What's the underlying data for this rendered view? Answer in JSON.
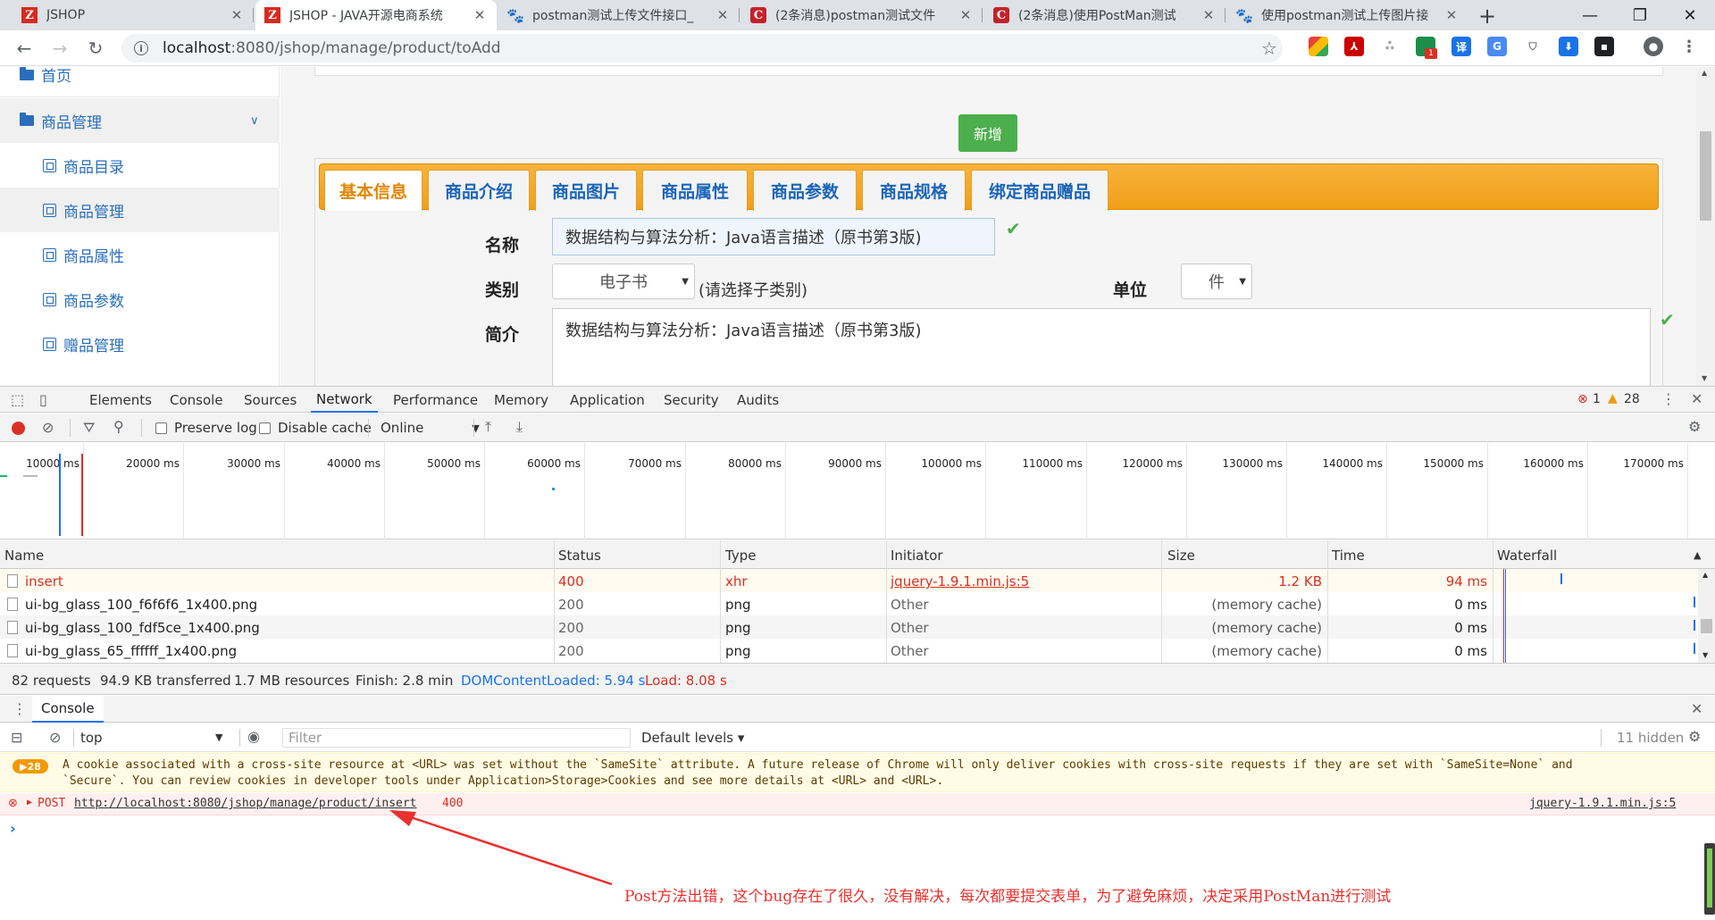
{
  "browser": {
    "tabs": [
      {
        "title": "JSHOP",
        "icon": "jshop-logo-icon"
      },
      {
        "title": "JSHOP - JAVA开源电商系统",
        "icon": "jshop-logo-icon"
      },
      {
        "title": "postman测试上传文件接口_",
        "icon": "baidu-paw-icon"
      },
      {
        "title": "(2条消息)postman测试文件",
        "icon": "csdn-logo-icon"
      },
      {
        "title": "(2条消息)使用PostMan测试",
        "icon": "csdn-logo-icon"
      },
      {
        "title": "使用postman测试上传图片接",
        "icon": "baidu-paw-icon"
      }
    ],
    "address": {
      "host": "localhost",
      "path": ":8080/jshop/manage/product/toAdd"
    },
    "ext_badge": "1",
    "ext_translate_label": "译"
  },
  "sidebar": {
    "home": "首页",
    "product_mgmt": "商品管理",
    "items": [
      "商品目录",
      "商品管理",
      "商品属性",
      "商品参数",
      "赠品管理"
    ]
  },
  "form": {
    "add_button": "新增",
    "tabs": [
      "基本信息",
      "商品介绍",
      "商品图片",
      "商品属性",
      "商品参数",
      "商品规格",
      "绑定商品赠品"
    ],
    "name_label": "名称",
    "name_value": "数据结构与算法分析：Java语言描述（原书第3版)",
    "category_label": "类别",
    "category_value": "电子书",
    "category_hint": "(请选择子类别)",
    "unit_label": "单位",
    "unit_value": "件",
    "intro_label": "简介",
    "intro_value": "数据结构与算法分析：Java语言描述（原书第3版)"
  },
  "devtools": {
    "tabs": [
      "Elements",
      "Console",
      "Sources",
      "Network",
      "Performance",
      "Memory",
      "Application",
      "Security",
      "Audits"
    ],
    "active_tab": "Network",
    "error_count": "1",
    "warning_count": "28",
    "preserve_log": "Preserve log",
    "disable_cache": "Disable cache",
    "throttle": "Online",
    "timeline_ticks": [
      "10000 ms",
      "20000 ms",
      "30000 ms",
      "40000 ms",
      "50000 ms",
      "60000 ms",
      "70000 ms",
      "80000 ms",
      "90000 ms",
      "100000 ms",
      "110000 ms",
      "120000 ms",
      "130000 ms",
      "140000 ms",
      "150000 ms",
      "160000 ms",
      "170000 ms"
    ],
    "columns": [
      "Name",
      "Status",
      "Type",
      "Initiator",
      "Size",
      "Time",
      "Waterfall"
    ],
    "rows": [
      {
        "name": "insert",
        "status": "400",
        "type": "xhr",
        "initiator": "jquery-1.9.1.min.js:5",
        "size": "1.2 KB",
        "time": "94 ms"
      },
      {
        "name": "ui-bg_glass_100_f6f6f6_1x400.png",
        "status": "200",
        "type": "png",
        "initiator": "Other",
        "size": "(memory cache)",
        "time": "0 ms"
      },
      {
        "name": "ui-bg_glass_100_fdf5ce_1x400.png",
        "status": "200",
        "type": "png",
        "initiator": "Other",
        "size": "(memory cache)",
        "time": "0 ms"
      },
      {
        "name": "ui-bg_glass_65_ffffff_1x400.png",
        "status": "200",
        "type": "png",
        "initiator": "Other",
        "size": "(memory cache)",
        "time": "0 ms"
      }
    ],
    "summary": {
      "requests": "82 requests",
      "transferred": "94.9 KB transferred",
      "resources": "1.7 MB resources",
      "finish": "Finish: 2.8 min",
      "dcl": "DOMContentLoaded: 5.94 s",
      "load": "Load: 8.08 s"
    },
    "console": {
      "title": "Console",
      "context": "top",
      "filter_placeholder": "Filter",
      "levels": "Default levels ▾",
      "hidden": "11 hidden",
      "warn_badge": "28",
      "warn_line1": "A cookie associated with a cross-site resource at <URL> was set without the `SameSite` attribute. A future release of Chrome will only deliver cookies with cross-site requests if they are set with `SameSite=None` and",
      "warn_line2": "`Secure`. You can review cookies in developer tools under Application>Storage>Cookies and see more details at <URL> and <URL>.",
      "err_method": "POST",
      "err_url": "http://localhost:8080/jshop/manage/product/insert",
      "err_status": "400",
      "err_source": "jquery-1.9.1.min.js:5"
    }
  },
  "annotation": "Post方法出错，这个bug存在了很久，没有解决，每次都要提交表单，为了避免麻烦，决定采用PostMan进行测试",
  "colors": {
    "accent": "#1a73e8",
    "error": "#d93025",
    "annotation": "#e8322e",
    "tab_orange": "#f19f18",
    "add_green": "#4cae4c"
  }
}
